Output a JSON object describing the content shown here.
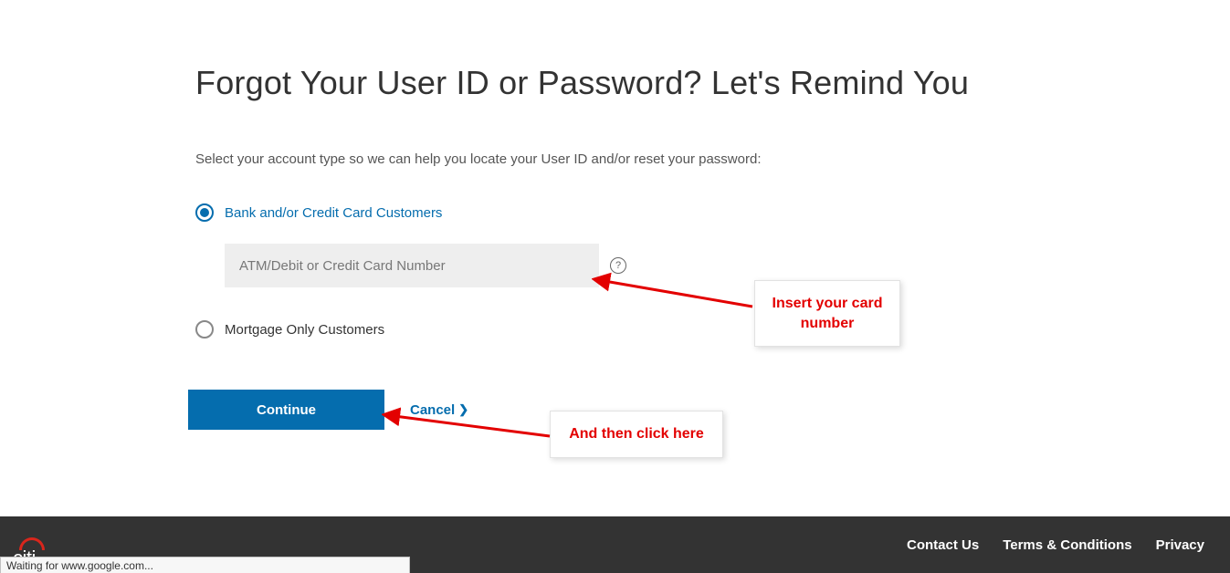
{
  "heading": "Forgot Your User ID or Password? Let's Remind You",
  "instruction": "Select your account type so we can help you locate your User ID and/or reset your password:",
  "options": {
    "bank": "Bank and/or Credit Card Customers",
    "mortgage": "Mortgage Only Customers"
  },
  "input": {
    "placeholder": "ATM/Debit or Credit Card Number",
    "help": "?"
  },
  "buttons": {
    "continue": "Continue",
    "cancel": "Cancel"
  },
  "callouts": {
    "c1": "Insert your card number",
    "c2": "And then click here"
  },
  "footer": {
    "logoText": "citi",
    "links": {
      "contact": "Contact Us",
      "terms": "Terms & Conditions",
      "privacy": "Privacy"
    }
  },
  "status": "Waiting for www.google.com..."
}
